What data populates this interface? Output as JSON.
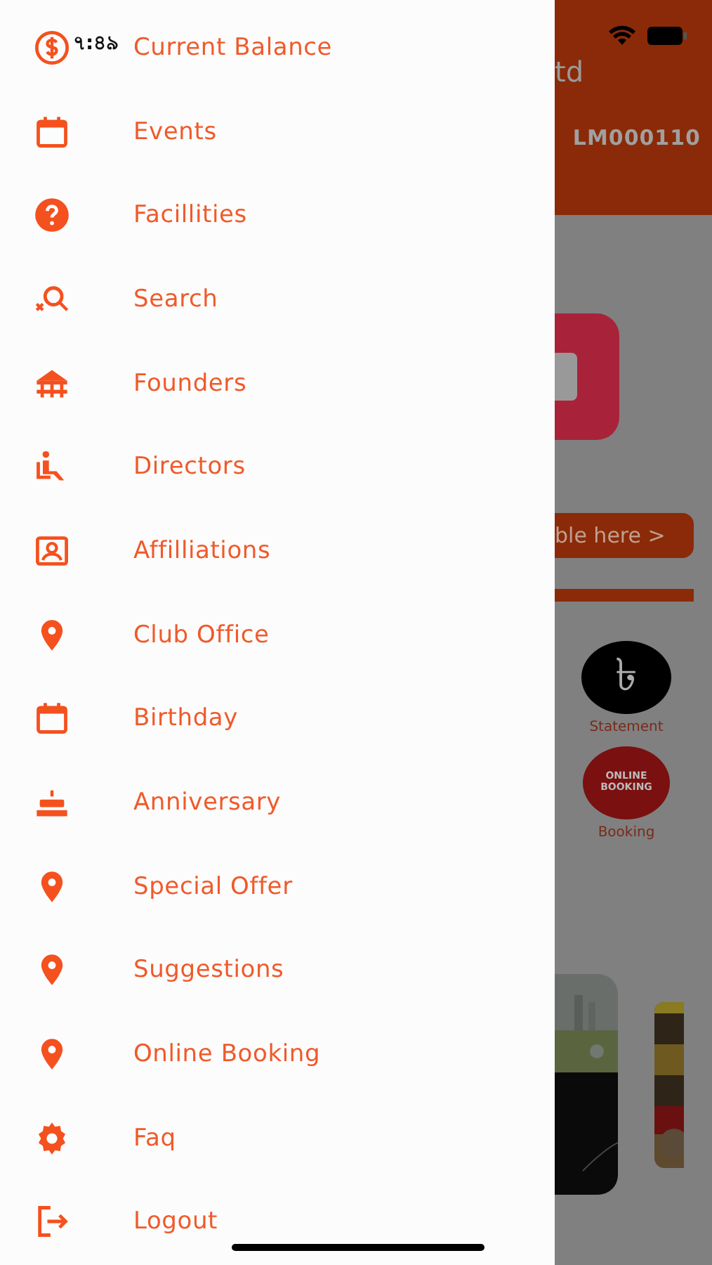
{
  "status_bar": {
    "time": "৭:৪৯"
  },
  "drawer": {
    "items": [
      {
        "label": "Current Balance",
        "kind": "dollar"
      },
      {
        "label": "Events",
        "kind": "calendar"
      },
      {
        "label": "Facillities",
        "kind": "help"
      },
      {
        "label": "Search",
        "kind": "search"
      },
      {
        "label": "Founders",
        "kind": "pavilion"
      },
      {
        "label": "Directors",
        "kind": "seat"
      },
      {
        "label": "Affilliations",
        "kind": "portrait"
      },
      {
        "label": "Club Office",
        "kind": "pin"
      },
      {
        "label": "Birthday",
        "kind": "calendar"
      },
      {
        "label": "Anniversary",
        "kind": "cake"
      },
      {
        "label": "Special Offer",
        "kind": "pin"
      },
      {
        "label": "Suggestions",
        "kind": "pin"
      },
      {
        "label": "Online Booking",
        "kind": "pin"
      },
      {
        "label": "Faq",
        "kind": "gear"
      },
      {
        "label": "Logout",
        "kind": "logout"
      }
    ]
  },
  "background": {
    "title": "td",
    "member_id": "LM000110",
    "banner_button": "ble here >",
    "shortcuts": [
      {
        "label": "Statement",
        "kind": "taka",
        "symbol": "৳"
      },
      {
        "label": "Booking",
        "kind": "online-booking",
        "badge": "ONLINE BOOKING"
      }
    ]
  }
}
